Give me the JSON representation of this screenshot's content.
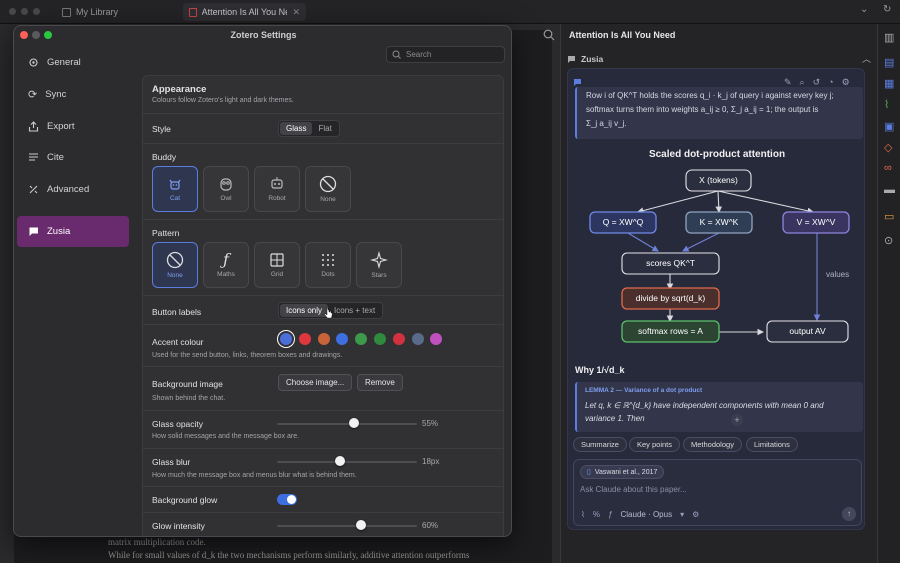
{
  "topbar": {
    "tabs": [
      {
        "label": "My Library"
      },
      {
        "label": "Attention Is All You Need"
      }
    ]
  },
  "pdf": {
    "line1": "matrix multiplication code.",
    "line2": "While for small values of d_k the two mechanisms perform similarly, additive attention outperforms"
  },
  "settings": {
    "title": "Zotero Settings",
    "search_placeholder": "Search",
    "nav": [
      {
        "label": "General",
        "icon": "gear-icon"
      },
      {
        "label": "Sync",
        "icon": "sync-icon"
      },
      {
        "label": "Export",
        "icon": "export-icon"
      },
      {
        "label": "Cite",
        "icon": "cite-icon"
      },
      {
        "label": "Advanced",
        "icon": "advanced-icon"
      },
      {
        "label": "Zusia",
        "icon": "chat-icon"
      }
    ],
    "appearance": {
      "title": "Appearance",
      "subtitle": "Colours follow Zotero's light and dark themes."
    },
    "style": {
      "label": "Style",
      "options": [
        "Glass",
        "Flat"
      ],
      "selected": "Glass"
    },
    "buddy": {
      "label": "Buddy",
      "options": [
        {
          "label": "Cat",
          "icon": "cat-icon"
        },
        {
          "label": "Owl",
          "icon": "owl-icon"
        },
        {
          "label": "Robot",
          "icon": "robot-icon"
        },
        {
          "label": "None",
          "icon": "none-icon"
        }
      ],
      "selected": "Cat"
    },
    "pattern": {
      "label": "Pattern",
      "options": [
        {
          "label": "None",
          "icon": "none-icon"
        },
        {
          "label": "Maths",
          "icon": "maths-icon"
        },
        {
          "label": "Grid",
          "icon": "grid-icon"
        },
        {
          "label": "Dots",
          "icon": "dots-icon"
        },
        {
          "label": "Stars",
          "icon": "stars-icon"
        }
      ],
      "selected": "None"
    },
    "button_labels": {
      "label": "Button labels",
      "options": [
        "Icons only",
        "Icons + text"
      ],
      "selected": "Icons only"
    },
    "accent": {
      "label": "Accent colour",
      "subtitle": "Used for the send button, links, theorem boxes and drawings.",
      "colors": [
        "#4a6fd8",
        "#e0373f",
        "#c9643a",
        "#3d6fe0",
        "#3d9a4a",
        "#2f8a3e",
        "#d2323f",
        "#5a6a8a",
        "#c050c0"
      ],
      "selected": "#4a6fd8"
    },
    "background_image": {
      "label": "Background image",
      "subtitle": "Shown behind the chat.",
      "choose_label": "Choose image...",
      "remove_label": "Remove"
    },
    "glass_opacity": {
      "label": "Glass opacity",
      "subtitle": "How solid messages and the message box are.",
      "value_text": "55%",
      "fraction": 0.55
    },
    "glass_blur": {
      "label": "Glass blur",
      "subtitle": "How much the message box and menus blur what is behind them.",
      "value_text": "18px",
      "fraction": 0.45
    },
    "background_glow": {
      "label": "Background glow",
      "on": true
    },
    "glow_intensity": {
      "label": "Glow intensity",
      "value_text": "60%",
      "fraction": 0.6
    }
  },
  "reader": {
    "title": "Attention Is All You Need",
    "section": "Zusia",
    "message_text_1": "Row i of QK^T holds the scores q_i · k_j of query i against every key j;",
    "message_text_2": "softmax turns them into weights a_ij ≥ 0, Σ_j a_ij = 1; the output is",
    "message_text_3": "Σ_j a_ij v_j.",
    "diagram": {
      "title": "Scaled dot-product attention",
      "nodes": {
        "x": "X (tokens)",
        "q": "Q = XW^Q",
        "k": "K = XW^K",
        "v": "V = XW^V",
        "scores": "scores QK^T",
        "divide": "divide by sqrt(d_k)",
        "softmax": "softmax rows = A",
        "output": "output AV"
      },
      "edge_label": "values"
    },
    "why_heading": "Why 1/√d_k",
    "lemma_title": "LEMMA 2 — Variance of a dot product",
    "lemma_text_1": "Let q, k ∈ ℝ^{d_k} have independent components with mean 0 and",
    "lemma_text_2": "variance 1. Then",
    "chips": [
      "Summarize",
      "Key points",
      "Methodology",
      "Limitations"
    ],
    "citation": "Vaswani et al., 2017",
    "input_placeholder": "Ask Claude about this paper...",
    "model_label": "Claude · Opus"
  }
}
